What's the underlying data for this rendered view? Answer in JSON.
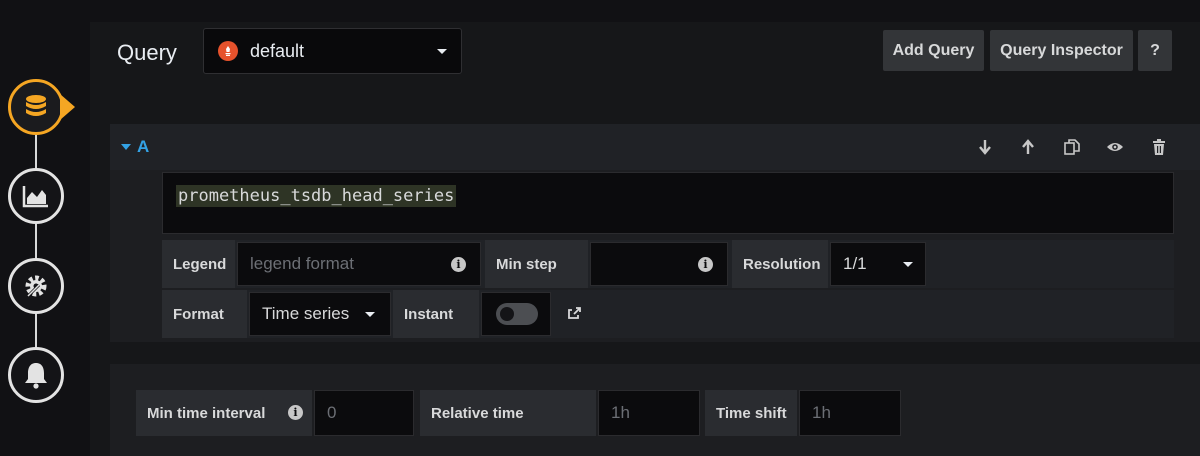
{
  "editor": {
    "title": "Query",
    "datasource": {
      "name": "default",
      "icon": "prometheus-icon",
      "icon_color": "#e6522c"
    },
    "buttons": {
      "add_query": "Add Query",
      "query_inspector": "Query Inspector",
      "help": "?"
    }
  },
  "sidenav": {
    "items": [
      {
        "icon": "database-icon",
        "active": true
      },
      {
        "icon": "area-chart-icon",
        "active": false
      },
      {
        "icon": "settings-icon",
        "active": false
      },
      {
        "icon": "bell-icon",
        "active": false
      }
    ],
    "accent_color": "#f5a623"
  },
  "query_row": {
    "ref_id": "A",
    "ref_color": "#33a2e5",
    "actions": [
      "arrow-down-icon",
      "arrow-up-icon",
      "duplicate-icon",
      "eye-icon",
      "trash-icon"
    ],
    "expression": "prometheus_tsdb_head_series",
    "legend": {
      "label": "Legend",
      "placeholder": "legend format",
      "value": ""
    },
    "min_step": {
      "label": "Min step",
      "value": ""
    },
    "resolution": {
      "label": "Resolution",
      "value": "1/1"
    },
    "format": {
      "label": "Format",
      "value": "Time series"
    },
    "instant": {
      "label": "Instant",
      "enabled": false
    },
    "external_link_icon": "external-link-icon"
  },
  "options": {
    "min_time_interval": {
      "label": "Min time interval",
      "placeholder": "0"
    },
    "relative_time": {
      "label": "Relative time",
      "placeholder": "1h"
    },
    "time_shift": {
      "label": "Time shift",
      "placeholder": "1h"
    }
  }
}
